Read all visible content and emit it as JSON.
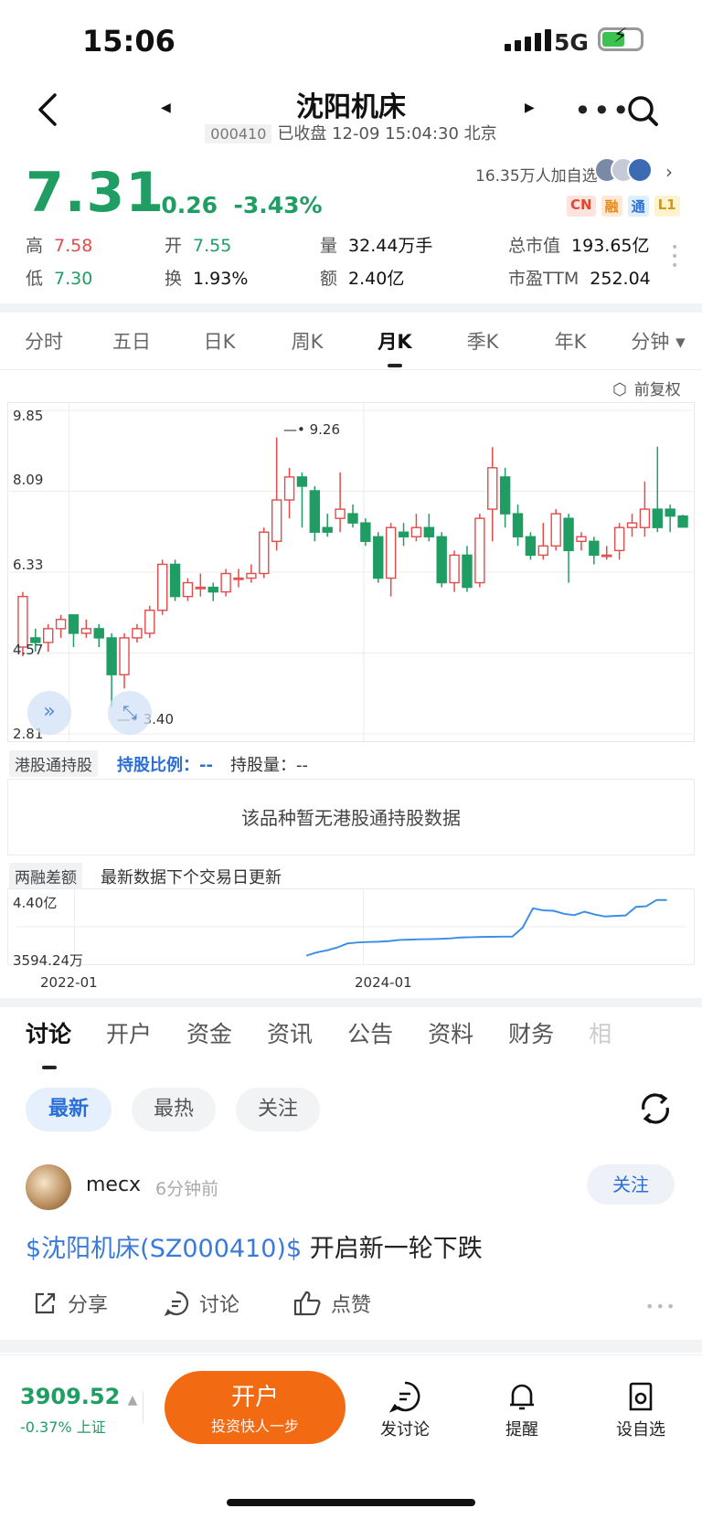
{
  "status": {
    "time": "15:06",
    "network": "5G"
  },
  "header": {
    "title": "沈阳机床",
    "code": "000410",
    "status_text": "已收盘 12-09 15:04:30 北京"
  },
  "quote": {
    "price": "7.31",
    "change": "-0.26",
    "change_pct": "-3.43%",
    "followers": "16.35万人加自选",
    "badges": [
      "CN",
      "融",
      "通",
      "L1"
    ],
    "stats": {
      "high_label": "高",
      "high": "7.58",
      "open_label": "开",
      "open": "7.55",
      "vol_label": "量",
      "vol": "32.44万手",
      "mcap_label": "总市值",
      "mcap": "193.65亿",
      "low_label": "低",
      "low": "7.30",
      "turn_label": "换",
      "turn": "1.93%",
      "amt_label": "额",
      "amt": "2.40亿",
      "pe_label": "市盈TTM",
      "pe": "252.04"
    }
  },
  "chart_tabs": [
    "分时",
    "五日",
    "日K",
    "周K",
    "月K",
    "季K",
    "年K",
    "分钟"
  ],
  "chart_data": [
    {
      "type": "candlestick",
      "title": "月K",
      "adjust": "前复权",
      "y_ticks": [
        "9.85",
        "8.09",
        "6.33",
        "4.57",
        "2.81"
      ],
      "ylim": [
        2.81,
        9.85
      ],
      "max_label": "9.26",
      "min_label": "3.40",
      "candles": [
        [
          4.7,
          5.8,
          4.5,
          5.9
        ],
        [
          4.9,
          4.8,
          4.6,
          5.1
        ],
        [
          4.8,
          5.1,
          4.6,
          5.2
        ],
        [
          5.1,
          5.3,
          4.9,
          5.4
        ],
        [
          5.4,
          5.0,
          4.7,
          5.4
        ],
        [
          5.0,
          5.1,
          4.9,
          5.3
        ],
        [
          5.1,
          4.9,
          4.7,
          5.2
        ],
        [
          4.9,
          4.1,
          3.4,
          5.0
        ],
        [
          4.1,
          4.9,
          3.8,
          5.0
        ],
        [
          4.9,
          5.1,
          4.8,
          5.2
        ],
        [
          5.0,
          5.5,
          4.9,
          5.6
        ],
        [
          5.5,
          6.5,
          5.4,
          6.6
        ],
        [
          6.5,
          5.8,
          5.7,
          6.6
        ],
        [
          5.8,
          6.1,
          5.7,
          6.2
        ],
        [
          6.0,
          6.0,
          5.8,
          6.3
        ],
        [
          6.0,
          5.9,
          5.7,
          6.1
        ],
        [
          5.9,
          6.3,
          5.8,
          6.4
        ],
        [
          6.2,
          6.2,
          6.0,
          6.4
        ],
        [
          6.2,
          6.3,
          6.1,
          6.5
        ],
        [
          6.3,
          7.2,
          6.2,
          7.3
        ],
        [
          7.0,
          7.9,
          6.8,
          9.26
        ],
        [
          7.9,
          8.4,
          7.5,
          8.6
        ],
        [
          8.4,
          8.2,
          7.3,
          8.5
        ],
        [
          8.1,
          7.2,
          7.0,
          8.2
        ],
        [
          7.3,
          7.2,
          7.1,
          7.6
        ],
        [
          7.5,
          7.7,
          7.2,
          8.5
        ],
        [
          7.6,
          7.4,
          7.3,
          7.8
        ],
        [
          7.4,
          7.0,
          6.9,
          7.5
        ],
        [
          7.1,
          6.2,
          6.1,
          7.2
        ],
        [
          6.2,
          7.3,
          5.8,
          7.4
        ],
        [
          7.2,
          7.1,
          6.9,
          7.4
        ],
        [
          7.1,
          7.3,
          7.0,
          7.6
        ],
        [
          7.3,
          7.1,
          7.0,
          7.6
        ],
        [
          7.1,
          6.1,
          6.0,
          7.2
        ],
        [
          6.1,
          6.7,
          5.9,
          6.8
        ],
        [
          6.7,
          6.0,
          5.9,
          6.9
        ],
        [
          6.1,
          7.5,
          6.0,
          7.6
        ],
        [
          7.7,
          8.6,
          7.0,
          9.05
        ],
        [
          8.4,
          7.6,
          7.3,
          8.6
        ],
        [
          7.6,
          7.1,
          6.9,
          7.8
        ],
        [
          7.1,
          6.7,
          6.6,
          7.2
        ],
        [
          6.7,
          6.9,
          6.6,
          7.4
        ],
        [
          6.9,
          7.6,
          6.8,
          7.7
        ],
        [
          7.5,
          6.8,
          6.1,
          7.6
        ],
        [
          7.0,
          7.1,
          6.8,
          7.2
        ],
        [
          7.0,
          6.7,
          6.5,
          7.1
        ],
        [
          6.7,
          6.7,
          6.6,
          6.9
        ],
        [
          6.8,
          7.3,
          6.6,
          7.4
        ],
        [
          7.3,
          7.4,
          7.1,
          7.6
        ],
        [
          7.3,
          7.7,
          7.1,
          8.3
        ],
        [
          7.7,
          7.3,
          7.2,
          9.06
        ],
        [
          7.7,
          7.55,
          7.2,
          7.8
        ],
        [
          7.55,
          7.31,
          7.3,
          7.58
        ]
      ]
    },
    {
      "type": "line",
      "title": "两融差额",
      "y_ticks": [
        "4.40亿",
        "3594.24万"
      ],
      "x_ticks": [
        "2022-01",
        "2024-01"
      ],
      "values": [
        0.36,
        0.6,
        0.75,
        0.95,
        1.25,
        1.32,
        1.35,
        1.37,
        1.42,
        1.5,
        1.52,
        1.55,
        1.56,
        1.58,
        1.62,
        1.68,
        1.7,
        1.72,
        1.73,
        1.74,
        1.75,
        2.4,
        3.8,
        3.65,
        3.62,
        3.4,
        3.3,
        3.55,
        3.35,
        3.2,
        3.25,
        3.28,
        3.9,
        3.95,
        4.4,
        4.4
      ]
    }
  ],
  "hk": {
    "label": "港股通持股",
    "ratio_label": "持股比例：",
    "ratio": "--",
    "qty_label": "持股量：",
    "qty": "--",
    "empty": "该品种暂无港股通持股数据"
  },
  "margin": {
    "label": "两融差额",
    "note": "最新数据下个交易日更新"
  },
  "discuss_tabs": [
    "讨论",
    "开户",
    "资金",
    "资讯",
    "公告",
    "资料",
    "财务",
    "相"
  ],
  "filters": [
    "最新",
    "最热",
    "关注"
  ],
  "post": {
    "user": "mecx",
    "ago": "6分钟前",
    "follow": "关注",
    "tag": "$沈阳机床(SZ000410)$",
    "text": " 开启新一轮下跌",
    "share": "分享",
    "discuss": "讨论",
    "like": "点赞"
  },
  "bottom": {
    "index_value": "3909.52",
    "index_change": "-0.37%",
    "index_name": "上证",
    "open_title": "开户",
    "open_sub": "投资快人一步",
    "post": "发讨论",
    "remind": "提醒",
    "watch": "设自选"
  },
  "colors": {
    "up": "#e44a4a",
    "down": "#1f9d63",
    "accent": "#2b6fd6",
    "cta": "#f26a12"
  }
}
